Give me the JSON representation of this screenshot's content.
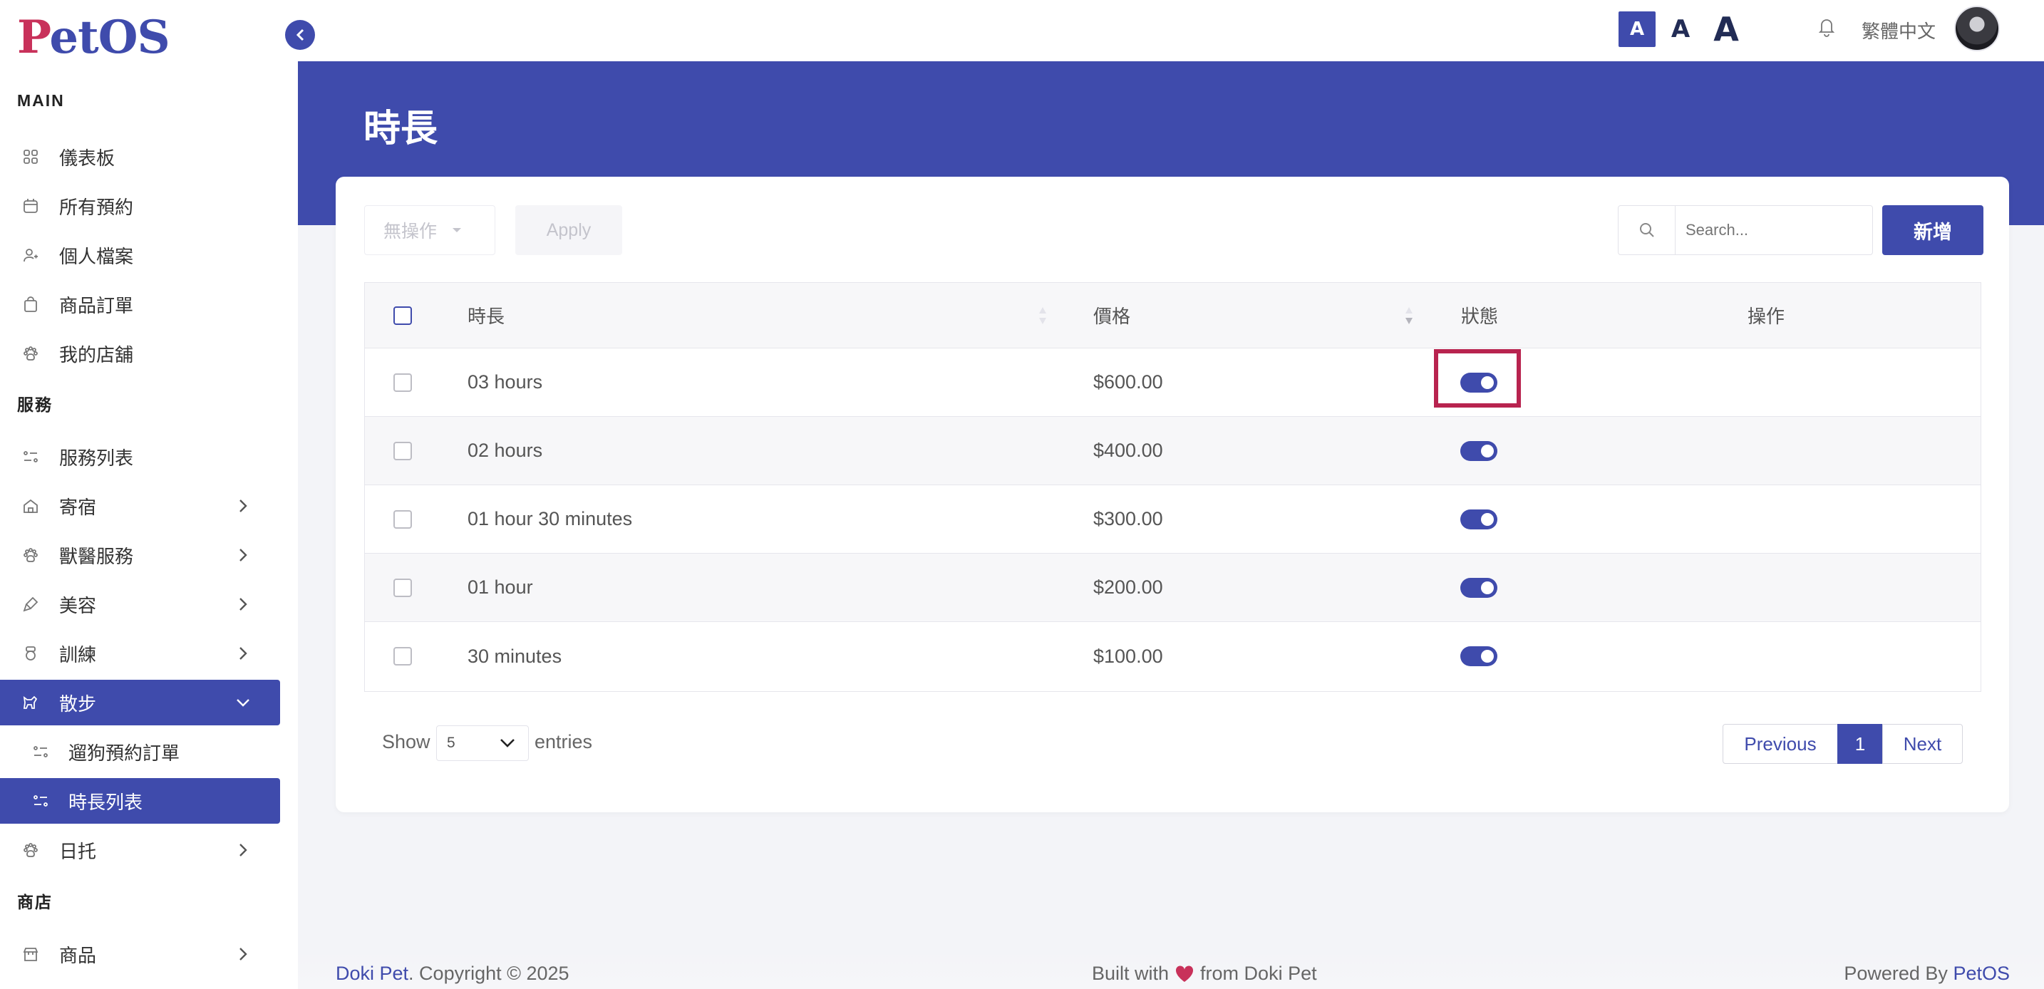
{
  "app": {
    "logo_prefix": "P",
    "logo_rest": "etOS"
  },
  "sidebar": {
    "section_main": "MAIN",
    "section_services": "服務",
    "section_shop": "商店",
    "items": [
      {
        "label": "儀表板",
        "icon": "grid-icon"
      },
      {
        "label": "所有預約",
        "icon": "calendar-icon"
      },
      {
        "label": "個人檔案",
        "icon": "user-icon"
      },
      {
        "label": "商品訂單",
        "icon": "bag-icon"
      },
      {
        "label": "我的店舖",
        "icon": "paw-icon"
      },
      {
        "label": "服務列表",
        "icon": "list-icon"
      },
      {
        "label": "寄宿",
        "icon": "home-icon"
      },
      {
        "label": "獸醫服務",
        "icon": "paw-icon"
      },
      {
        "label": "美容",
        "icon": "brush-icon"
      },
      {
        "label": "訓練",
        "icon": "medal-icon"
      },
      {
        "label": "散步",
        "icon": "dog-walk-icon"
      },
      {
        "label": "遛狗預約訂單",
        "icon": "list-icon"
      },
      {
        "label": "時長列表",
        "icon": "list-icon"
      },
      {
        "label": "日托",
        "icon": "paw-icon"
      },
      {
        "label": "商品",
        "icon": "store-icon"
      }
    ]
  },
  "topbar": {
    "font_small": "A",
    "font_medium": "A",
    "font_large": "A",
    "language": "繁體中文"
  },
  "page": {
    "title": "時長"
  },
  "toolbar": {
    "bulk_action": "無操作",
    "apply": "Apply",
    "search_placeholder": "Search...",
    "add": "新增"
  },
  "table": {
    "headers": {
      "duration": "時長",
      "price": "價格",
      "status": "狀態",
      "actions": "操作"
    },
    "rows": [
      {
        "duration": "03 hours",
        "price": "$600.00",
        "enabled": true
      },
      {
        "duration": "02 hours",
        "price": "$400.00",
        "enabled": true
      },
      {
        "duration": "01 hour 30 minutes",
        "price": "$300.00",
        "enabled": true
      },
      {
        "duration": "01 hour",
        "price": "$200.00",
        "enabled": true
      },
      {
        "duration": "30 minutes",
        "price": "$100.00",
        "enabled": true
      }
    ]
  },
  "pagination": {
    "show_label": "Show",
    "page_size": "5",
    "entries_label": "entries",
    "previous": "Previous",
    "current": "1",
    "next": "Next"
  },
  "footer": {
    "brand": "Doki Pet",
    "copyright": ". Copyright © 2025",
    "built_prefix": "Built with",
    "built_suffix": "from Doki Pet",
    "powered_prefix": "Powered By",
    "powered_brand": "PetOS"
  },
  "colors": {
    "primary": "#3f4bac",
    "accent": "#b8234f",
    "heart": "#c8315a"
  }
}
